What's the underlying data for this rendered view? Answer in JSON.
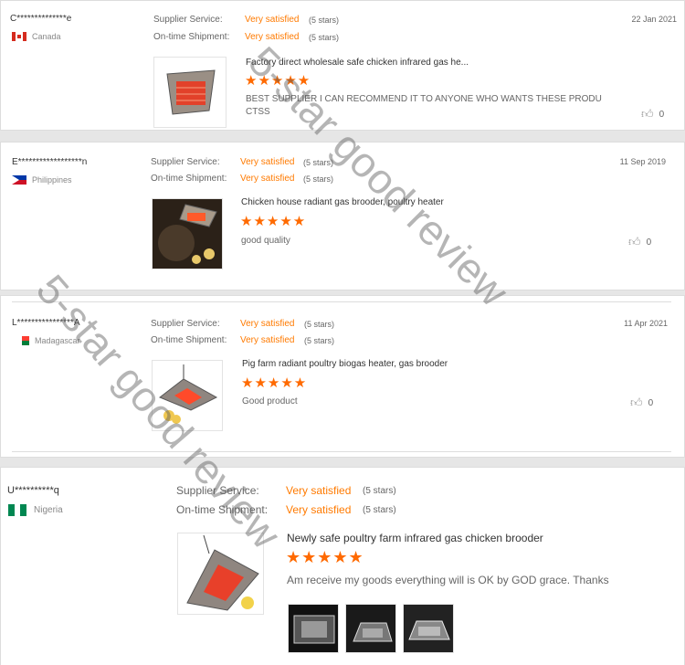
{
  "labels": {
    "supplier_service": "Supplier Service:",
    "ontime_shipment": "On-time Shipment:"
  },
  "reviews": [
    {
      "buyer": "C**************e",
      "country": "Canada",
      "supplier_service": "Very satisfied",
      "supplier_stars": "(5 stars)",
      "shipment": "Very satisfied",
      "shipment_stars": "(5 stars)",
      "date": "22 Jan 2021",
      "product": "Factory direct wholesale safe chicken infrared gas he...",
      "rating": "★★★★★",
      "text": "BEST SUPPLIER I CAN RECOMMEND IT TO ANYONE WHO WANTS THESE PRODU CTSS",
      "likes": "0"
    },
    {
      "buyer": "E******************n",
      "country": "Philippines",
      "supplier_service": "Very satisfied",
      "supplier_stars": "(5 stars)",
      "shipment": "Very satisfied",
      "shipment_stars": "(5 stars)",
      "date": "11 Sep 2019",
      "product": "Chicken house radiant gas brooder, poultry heater",
      "rating": "★★★★★",
      "text": "good quality",
      "likes": "0"
    },
    {
      "buyer": "L****************A",
      "country": "Madagascar",
      "supplier_service": "Very satisfied",
      "supplier_stars": "(5 stars)",
      "shipment": "Very satisfied",
      "shipment_stars": "(5 stars)",
      "date": "11 Apr 2021",
      "product": "Pig farm radiant poultry biogas heater, gas brooder",
      "rating": "★★★★★",
      "text": "Good product",
      "likes": "0"
    },
    {
      "buyer": "U**********q",
      "country": "Nigeria",
      "supplier_service": "Very satisfied",
      "supplier_stars": "(5 stars)",
      "shipment": "Very satisfied",
      "shipment_stars": "(5 stars)",
      "product": "Newly safe poultry farm infrared gas chicken brooder",
      "rating": "★★★★★",
      "text": "Am receive my goods everything will is OK by GOD grace. Thanks"
    }
  ],
  "watermark": [
    "5-star good review",
    "5-star good review"
  ],
  "colors": {
    "accent": "#ff7a00",
    "star": "#ff6a00"
  }
}
